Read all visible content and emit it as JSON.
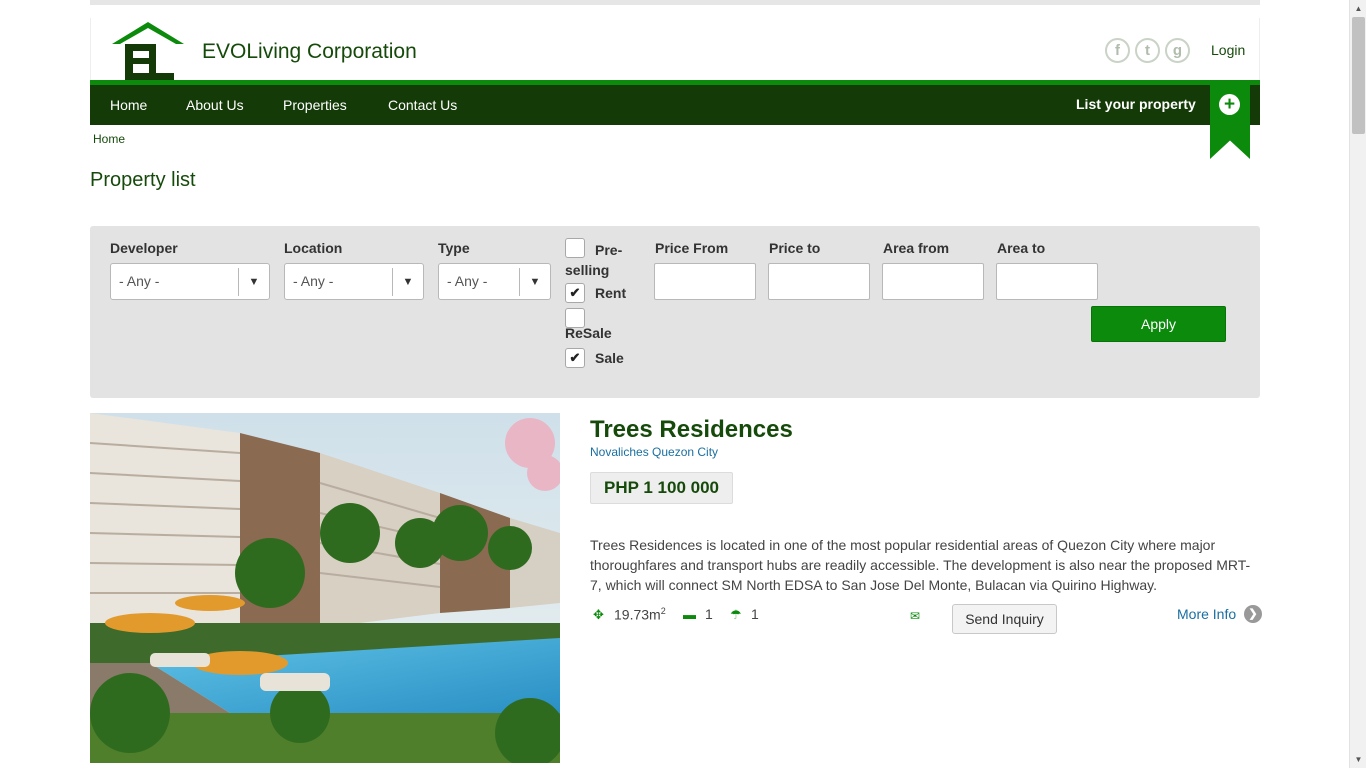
{
  "site": {
    "brand": "EVOLiving Corporation",
    "login_label": "Login",
    "social": [
      "facebook-icon",
      "tumblr-icon",
      "google-icon"
    ],
    "social_glyphs": [
      "f",
      "t",
      "g"
    ],
    "colors": {
      "nav_bg": "#143b07",
      "accent": "#0b8a0b",
      "title": "#164a0b",
      "link": "#1a6fa0"
    }
  },
  "nav": {
    "items": [
      {
        "label": "Home"
      },
      {
        "label": "About Us"
      },
      {
        "label": "Properties"
      },
      {
        "label": "Contact Us"
      }
    ],
    "list_property_label": "List your property"
  },
  "breadcrumb": "Home",
  "page_title": "Property list",
  "filters": {
    "developer": {
      "label": "Developer",
      "value": "- Any -"
    },
    "location": {
      "label": "Location",
      "value": "- Any -"
    },
    "type": {
      "label": "Type",
      "value": "- Any -"
    },
    "checkboxes": [
      {
        "label": "Pre-selling",
        "checked": false
      },
      {
        "label": "Rent",
        "checked": true
      },
      {
        "label": "ReSale",
        "checked": false
      },
      {
        "label": "Sale",
        "checked": true
      }
    ],
    "price_from_label": "Price From",
    "price_to_label": "Price to",
    "area_from_label": "Area from",
    "area_to_label": "Area to",
    "apply_label": "Apply"
  },
  "listing": {
    "title": "Trees Residences",
    "location": "Novaliches Quezon City",
    "price": "PHP 1 100 000",
    "description": "Trees Residences is located in one of the most popular residential areas of Quezon City where major thoroughfares and transport hubs are readily accessible. The development is also near the proposed MRT-7, which will connect SM North EDSA to San Jose Del Monte, Bulacan via Quirino Highway.",
    "area_value": "19.73m",
    "area_sup": "2",
    "bedrooms": "1",
    "bathrooms": "1",
    "send_inquiry_label": "Send Inquiry",
    "more_info_label": "More Info"
  }
}
